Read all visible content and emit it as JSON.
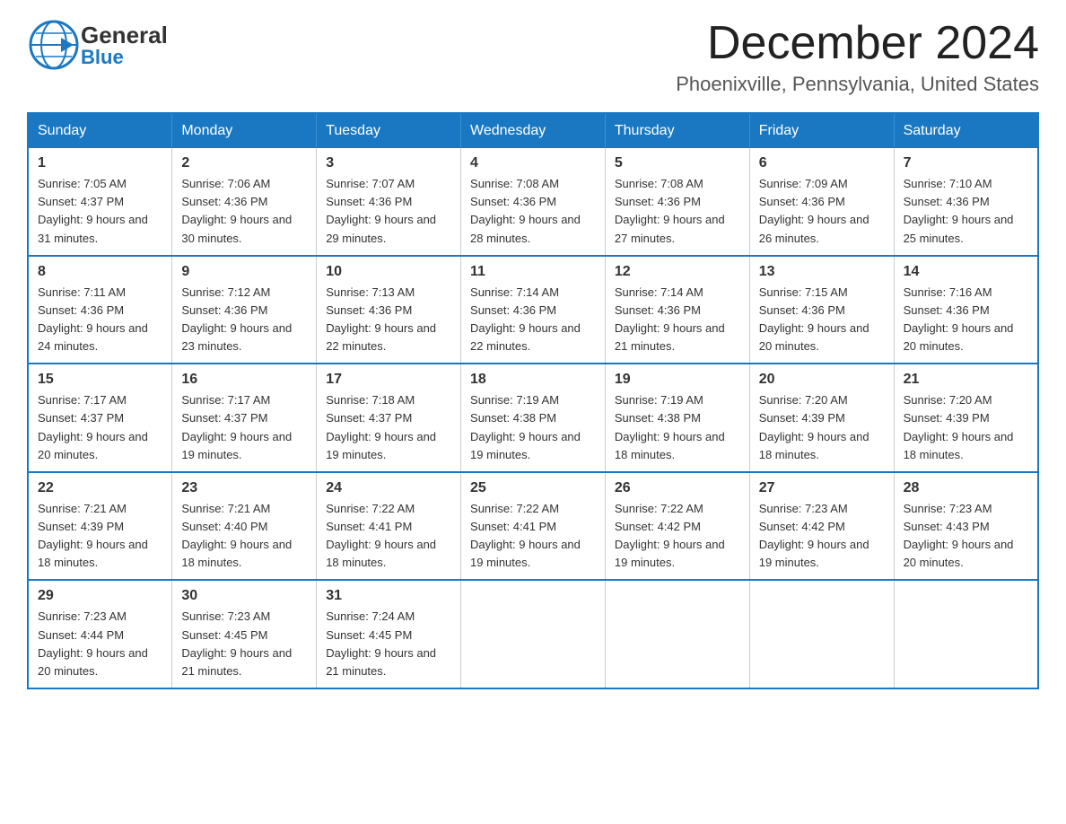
{
  "header": {
    "logo": {
      "general": "General",
      "blue": "Blue",
      "arrow": "▶"
    },
    "title": "December 2024",
    "subtitle": "Phoenixville, Pennsylvania, United States"
  },
  "calendar": {
    "days_of_week": [
      "Sunday",
      "Monday",
      "Tuesday",
      "Wednesday",
      "Thursday",
      "Friday",
      "Saturday"
    ],
    "weeks": [
      [
        {
          "day": "1",
          "sunrise": "7:05 AM",
          "sunset": "4:37 PM",
          "daylight": "9 hours and 31 minutes."
        },
        {
          "day": "2",
          "sunrise": "7:06 AM",
          "sunset": "4:36 PM",
          "daylight": "9 hours and 30 minutes."
        },
        {
          "day": "3",
          "sunrise": "7:07 AM",
          "sunset": "4:36 PM",
          "daylight": "9 hours and 29 minutes."
        },
        {
          "day": "4",
          "sunrise": "7:08 AM",
          "sunset": "4:36 PM",
          "daylight": "9 hours and 28 minutes."
        },
        {
          "day": "5",
          "sunrise": "7:08 AM",
          "sunset": "4:36 PM",
          "daylight": "9 hours and 27 minutes."
        },
        {
          "day": "6",
          "sunrise": "7:09 AM",
          "sunset": "4:36 PM",
          "daylight": "9 hours and 26 minutes."
        },
        {
          "day": "7",
          "sunrise": "7:10 AM",
          "sunset": "4:36 PM",
          "daylight": "9 hours and 25 minutes."
        }
      ],
      [
        {
          "day": "8",
          "sunrise": "7:11 AM",
          "sunset": "4:36 PM",
          "daylight": "9 hours and 24 minutes."
        },
        {
          "day": "9",
          "sunrise": "7:12 AM",
          "sunset": "4:36 PM",
          "daylight": "9 hours and 23 minutes."
        },
        {
          "day": "10",
          "sunrise": "7:13 AM",
          "sunset": "4:36 PM",
          "daylight": "9 hours and 22 minutes."
        },
        {
          "day": "11",
          "sunrise": "7:14 AM",
          "sunset": "4:36 PM",
          "daylight": "9 hours and 22 minutes."
        },
        {
          "day": "12",
          "sunrise": "7:14 AM",
          "sunset": "4:36 PM",
          "daylight": "9 hours and 21 minutes."
        },
        {
          "day": "13",
          "sunrise": "7:15 AM",
          "sunset": "4:36 PM",
          "daylight": "9 hours and 20 minutes."
        },
        {
          "day": "14",
          "sunrise": "7:16 AM",
          "sunset": "4:36 PM",
          "daylight": "9 hours and 20 minutes."
        }
      ],
      [
        {
          "day": "15",
          "sunrise": "7:17 AM",
          "sunset": "4:37 PM",
          "daylight": "9 hours and 20 minutes."
        },
        {
          "day": "16",
          "sunrise": "7:17 AM",
          "sunset": "4:37 PM",
          "daylight": "9 hours and 19 minutes."
        },
        {
          "day": "17",
          "sunrise": "7:18 AM",
          "sunset": "4:37 PM",
          "daylight": "9 hours and 19 minutes."
        },
        {
          "day": "18",
          "sunrise": "7:19 AM",
          "sunset": "4:38 PM",
          "daylight": "9 hours and 19 minutes."
        },
        {
          "day": "19",
          "sunrise": "7:19 AM",
          "sunset": "4:38 PM",
          "daylight": "9 hours and 18 minutes."
        },
        {
          "day": "20",
          "sunrise": "7:20 AM",
          "sunset": "4:39 PM",
          "daylight": "9 hours and 18 minutes."
        },
        {
          "day": "21",
          "sunrise": "7:20 AM",
          "sunset": "4:39 PM",
          "daylight": "9 hours and 18 minutes."
        }
      ],
      [
        {
          "day": "22",
          "sunrise": "7:21 AM",
          "sunset": "4:39 PM",
          "daylight": "9 hours and 18 minutes."
        },
        {
          "day": "23",
          "sunrise": "7:21 AM",
          "sunset": "4:40 PM",
          "daylight": "9 hours and 18 minutes."
        },
        {
          "day": "24",
          "sunrise": "7:22 AM",
          "sunset": "4:41 PM",
          "daylight": "9 hours and 18 minutes."
        },
        {
          "day": "25",
          "sunrise": "7:22 AM",
          "sunset": "4:41 PM",
          "daylight": "9 hours and 19 minutes."
        },
        {
          "day": "26",
          "sunrise": "7:22 AM",
          "sunset": "4:42 PM",
          "daylight": "9 hours and 19 minutes."
        },
        {
          "day": "27",
          "sunrise": "7:23 AM",
          "sunset": "4:42 PM",
          "daylight": "9 hours and 19 minutes."
        },
        {
          "day": "28",
          "sunrise": "7:23 AM",
          "sunset": "4:43 PM",
          "daylight": "9 hours and 20 minutes."
        }
      ],
      [
        {
          "day": "29",
          "sunrise": "7:23 AM",
          "sunset": "4:44 PM",
          "daylight": "9 hours and 20 minutes."
        },
        {
          "day": "30",
          "sunrise": "7:23 AM",
          "sunset": "4:45 PM",
          "daylight": "9 hours and 21 minutes."
        },
        {
          "day": "31",
          "sunrise": "7:24 AM",
          "sunset": "4:45 PM",
          "daylight": "9 hours and 21 minutes."
        },
        null,
        null,
        null,
        null
      ]
    ]
  }
}
